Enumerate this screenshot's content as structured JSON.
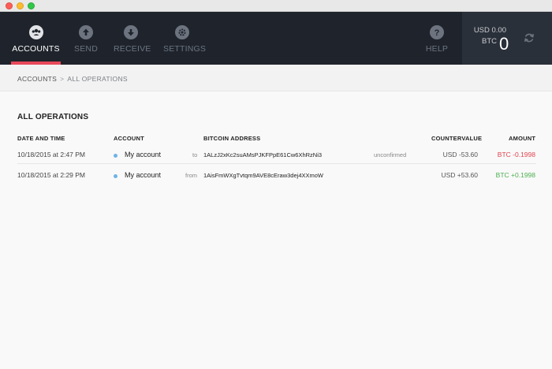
{
  "window": {
    "controls": [
      "close",
      "minimize",
      "maximize"
    ]
  },
  "nav": {
    "items": [
      {
        "label": "ACCOUNTS",
        "icon": "accounts-icon",
        "active": true
      },
      {
        "label": "SEND",
        "icon": "send-arrow-up-icon",
        "active": false
      },
      {
        "label": "RECEIVE",
        "icon": "receive-arrow-down-icon",
        "active": false
      },
      {
        "label": "SETTINGS",
        "icon": "gear-icon",
        "active": false
      }
    ],
    "help": {
      "label": "HELP",
      "icon": "help-question-icon"
    }
  },
  "balance": {
    "usd_text": "USD 0.00",
    "btc_label": "BTC",
    "btc_value": "0",
    "sync_icon": "sync-refresh-icon"
  },
  "breadcrumb": {
    "first": "ACCOUNTS",
    "separator": ">",
    "current": "ALL OPERATIONS"
  },
  "page": {
    "title": "ALL OPERATIONS"
  },
  "table": {
    "headers": {
      "date": "DATE AND TIME",
      "account": "ACCOUNT",
      "address": "BITCOIN ADDRESS",
      "countervalue": "COUNTERVALUE",
      "amount": "AMOUNT"
    },
    "rows": [
      {
        "date": "10/18/2015 at 2:47 PM",
        "account": "My account",
        "direction": "to",
        "address": "1ALzJ2xKc2suAMsPJKFPpE61Cw6XhRzNi3",
        "status": "unconfirmed",
        "countervalue": "USD -53.60",
        "amount": "BTC -0.1998"
      },
      {
        "date": "10/18/2015 at 2:29 PM",
        "account": "My account",
        "direction": "from",
        "address": "1AisFmWXgTvtqm9AVE8cEraw3dej4XXmoW",
        "status": "",
        "countervalue": "USD +53.60",
        "amount": "BTC +0.1998"
      }
    ]
  },
  "colors": {
    "nav_bg": "#1f242c",
    "accent_red": "#e8485a",
    "negative": "#e2434f",
    "positive": "#4caf50",
    "account_dot": "#6fb3e6"
  }
}
